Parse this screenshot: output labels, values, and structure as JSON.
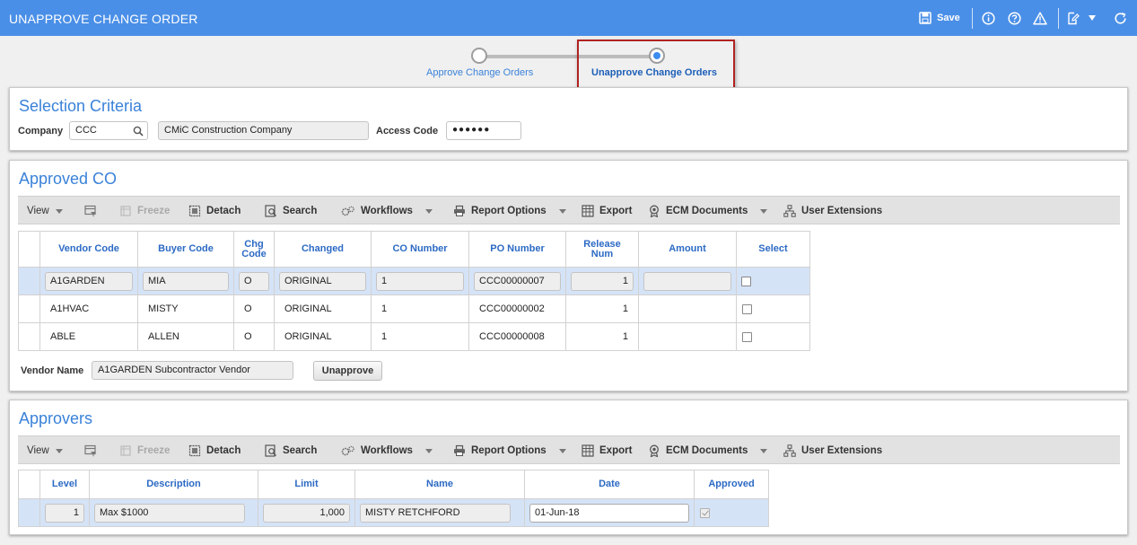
{
  "header": {
    "title": "UNAPPROVE CHANGE ORDER",
    "save_label": "Save"
  },
  "steps": [
    {
      "label": "Approve Change Orders"
    },
    {
      "label": "Unapprove Change Orders"
    }
  ],
  "selection": {
    "title": "Selection Criteria",
    "company_label": "Company",
    "company_value": "CCC",
    "company_name": "CMiC Construction Company",
    "access_label": "Access Code",
    "access_value": "●●●●●●"
  },
  "toolbar": {
    "view": "View",
    "freeze": "Freeze",
    "detach": "Detach",
    "search": "Search",
    "workflows": "Workflows",
    "report_options": "Report Options",
    "export": "Export",
    "ecm_documents": "ECM Documents",
    "user_extensions": "User Extensions"
  },
  "approved_co": {
    "title": "Approved CO",
    "columns": [
      "Vendor Code",
      "Buyer Code",
      "Chg Code",
      "Changed",
      "CO Number",
      "PO Number",
      "Release Num",
      "Amount",
      "Select"
    ],
    "rows": [
      {
        "vendor": "A1GARDEN",
        "buyer": "MIA",
        "chg": "O",
        "changed": "ORIGINAL",
        "co": "1",
        "po": "CCC00000007",
        "release": "1",
        "amount": "",
        "select": false
      },
      {
        "vendor": "A1HVAC",
        "buyer": "MISTY",
        "chg": "O",
        "changed": "ORIGINAL",
        "co": "1",
        "po": "CCC00000002",
        "release": "1",
        "amount": "",
        "select": false
      },
      {
        "vendor": "ABLE",
        "buyer": "ALLEN",
        "chg": "O",
        "changed": "ORIGINAL",
        "co": "1",
        "po": "CCC00000008",
        "release": "1",
        "amount": "",
        "select": false
      }
    ],
    "vendor_name_label": "Vendor Name",
    "vendor_name_value": "A1GARDEN Subcontractor Vendor",
    "unapprove_label": "Unapprove"
  },
  "approvers": {
    "title": "Approvers",
    "columns": [
      "Level",
      "Description",
      "Limit",
      "Name",
      "Date",
      "Approved"
    ],
    "rows": [
      {
        "level": "1",
        "description": "Max $1000",
        "limit": "1,000",
        "name": "MISTY RETCHFORD",
        "date": "01-Jun-18",
        "approved": true
      }
    ]
  },
  "colors": {
    "header_bg": "#4a8fe7",
    "title_text": "#3a82d9",
    "column_header_text": "#2c6ac4",
    "selected_row": "#d5e3f7",
    "highlight_box": "#b22222",
    "active_step": "#3b8df0"
  }
}
